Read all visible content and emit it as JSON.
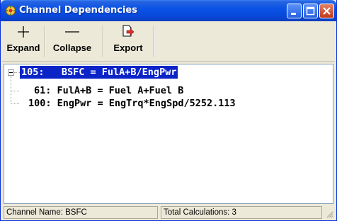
{
  "window": {
    "title": "Channel Dependencies",
    "app_icon": "channel-network-icon"
  },
  "title_buttons": {
    "minimize": "minimize-icon",
    "maximize": "maximize-icon",
    "close": "close-icon"
  },
  "toolbar": {
    "expand_label": "Expand",
    "collapse_label": "Collapse",
    "export_label": "Export"
  },
  "tree": {
    "root": "105:   BSFC = FulA+B/EngPwr",
    "children": [
      "61: FulA+B = Fuel A+Fuel B",
      "100: EngPwr = EngTrq*EngSpd/5252.113"
    ]
  },
  "status": {
    "channel_name": "Channel Name: BSFC",
    "total_calculations": "Total Calculations: 3"
  },
  "colors": {
    "titlebar": "#0a53e6",
    "selection": "#0a24c8",
    "chrome": "#ece9d8"
  }
}
